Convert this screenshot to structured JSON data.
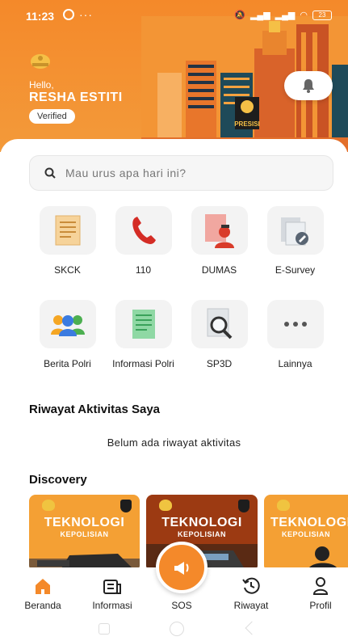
{
  "status_bar": {
    "time": "11:23",
    "dots": "···",
    "battery": "23"
  },
  "header": {
    "greeting": "Hello,",
    "user_name": "RESHA ESTITI",
    "verified_label": "Verified",
    "building_sign": "PRESISI"
  },
  "search": {
    "placeholder": "Mau urus apa hari ini?"
  },
  "menu": [
    {
      "label": "SKCK",
      "icon": "document-certificate-icon"
    },
    {
      "label": "110",
      "icon": "phone-icon"
    },
    {
      "label": "DUMAS",
      "icon": "complaint-person-icon"
    },
    {
      "label": "E-Survey",
      "icon": "survey-edit-icon"
    },
    {
      "label": "Berita Polri",
      "icon": "people-group-icon"
    },
    {
      "label": "Informasi Polri",
      "icon": "info-document-icon"
    },
    {
      "label": "SP3D",
      "icon": "magnifier-document-icon"
    },
    {
      "label": "Lainnya",
      "icon": "more-dots-icon"
    }
  ],
  "activity": {
    "title": "Riwayat Aktivitas Saya",
    "empty_text": "Belum ada riwayat aktivitas"
  },
  "discovery": {
    "title": "Discovery",
    "cards": [
      {
        "title": "TEKNOLOGI",
        "subtitle": "KEPOLISIAN",
        "color": "#f4a034"
      },
      {
        "title": "TEKNOLOGI",
        "subtitle": "KEPOLISIAN",
        "color": "#9c3a12"
      },
      {
        "title": "TEKNOLOGI",
        "subtitle": "KEPOLISIAN",
        "color": "#f4a034"
      }
    ]
  },
  "nav": {
    "items": [
      {
        "label": "Beranda",
        "icon": "home-icon",
        "active": true
      },
      {
        "label": "Informasi",
        "icon": "news-icon"
      },
      {
        "label": "SOS",
        "icon": "sos-megaphone-icon"
      },
      {
        "label": "Riwayat",
        "icon": "history-clock-icon"
      },
      {
        "label": "Profil",
        "icon": "profile-icon"
      }
    ]
  },
  "colors": {
    "brand": "#f4892a",
    "text": "#1b1b1b",
    "tile": "#f3f3f3"
  }
}
